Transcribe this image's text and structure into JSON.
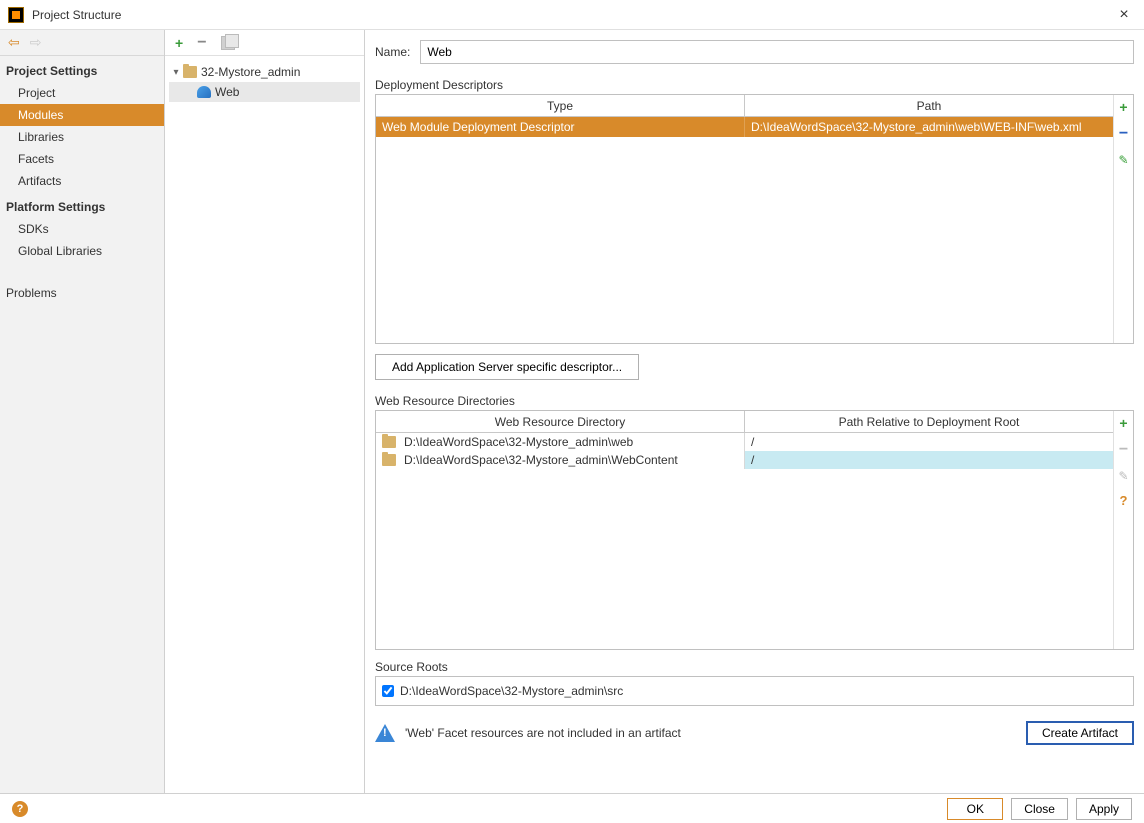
{
  "window": {
    "title": "Project Structure"
  },
  "sidebar": {
    "project_settings_title": "Project Settings",
    "platform_settings_title": "Platform Settings",
    "items_project": [
      {
        "label": "Project"
      },
      {
        "label": "Modules"
      },
      {
        "label": "Libraries"
      },
      {
        "label": "Facets"
      },
      {
        "label": "Artifacts"
      }
    ],
    "items_platform": [
      {
        "label": "SDKs"
      },
      {
        "label": "Global Libraries"
      }
    ],
    "problems_label": "Problems"
  },
  "tree": {
    "module_name": "32-Mystore_admin",
    "facet_name": "Web"
  },
  "main": {
    "name_label": "Name:",
    "name_value": "Web",
    "dd_title": "Deployment Descriptors",
    "dd_col_type": "Type",
    "dd_col_path": "Path",
    "dd_rows": [
      {
        "type": "Web Module Deployment Descriptor",
        "path": "D:\\IdeaWordSpace\\32-Mystore_admin\\web\\WEB-INF\\web.xml"
      }
    ],
    "add_server_btn": "Add Application Server specific descriptor...",
    "wrd_title": "Web Resource Directories",
    "wrd_col_dir": "Web Resource Directory",
    "wrd_col_path": "Path Relative to Deployment Root",
    "wrd_rows": [
      {
        "dir": "D:\\IdeaWordSpace\\32-Mystore_admin\\web",
        "path": "/"
      },
      {
        "dir": "D:\\IdeaWordSpace\\32-Mystore_admin\\WebContent",
        "path": "/"
      }
    ],
    "sr_title": "Source Roots",
    "sr_value": "D:\\IdeaWordSpace\\32-Mystore_admin\\src",
    "warning_msg": "'Web' Facet resources are not included in an artifact",
    "create_artifact_btn": "Create Artifact"
  },
  "footer": {
    "ok": "OK",
    "close": "Close",
    "apply": "Apply"
  }
}
